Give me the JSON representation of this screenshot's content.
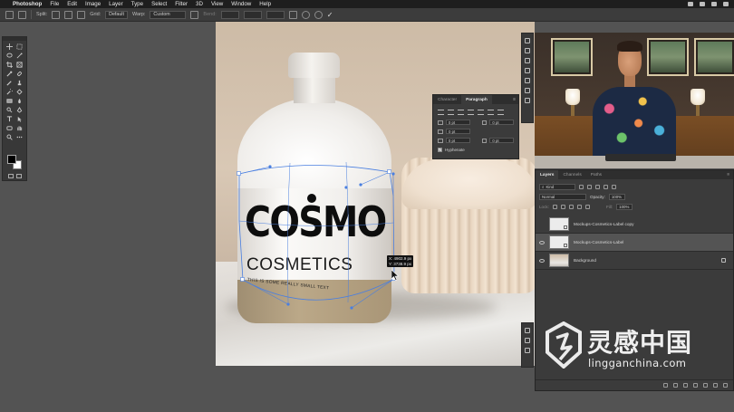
{
  "menubar": {
    "app": "Photoshop",
    "items": [
      "File",
      "Edit",
      "Image",
      "Layer",
      "Type",
      "Select",
      "Filter",
      "3D",
      "View",
      "Window",
      "Help"
    ]
  },
  "options": {
    "split_label": "Split:",
    "grid_label": "Grid:",
    "grid_value": "Default",
    "warp_label": "Warp:",
    "warp_value": "Custom",
    "bend_label": "Bend:"
  },
  "canvas": {
    "brand": "COSMO",
    "subtitle": "COSMETICS",
    "small_text": "THIS IS SOME REALLY SMALL TEXT",
    "coord_x": "X: 4902.9 px",
    "coord_y": "Y: 3738.9 px"
  },
  "paragraph_panel": {
    "tabs": [
      "Character",
      "Paragraph"
    ],
    "active_tab": "Paragraph",
    "fields": [
      "0 pt",
      "0 pt",
      "0 pt",
      "0 pt",
      "0 pt"
    ],
    "hyphenate_label": "Hyphenate",
    "hyphenate_checked": true
  },
  "layers_panel": {
    "tabs": [
      "Layers",
      "Channels",
      "Paths"
    ],
    "active_tab": "Layers",
    "kind_placeholder": "Kind",
    "blend_mode": "Normal",
    "opacity_label": "Opacity:",
    "opacity_value": "100%",
    "lock_label": "Lock:",
    "fill_label": "Fill:",
    "fill_value": "100%",
    "layers": [
      {
        "name": "Mockups-Cosmetics-Label copy",
        "visible": false,
        "selected": false
      },
      {
        "name": "Mockups-Cosmetics-Label",
        "visible": true,
        "selected": true
      },
      {
        "name": "Background",
        "visible": true,
        "selected": false,
        "locked": true
      }
    ]
  },
  "watermark": {
    "cn": "灵感中国",
    "url": "lingganchina.com"
  },
  "colors": {
    "accent_warp": "#4a7fe0",
    "panel": "#3b3b3b",
    "workspace": "#535353"
  }
}
